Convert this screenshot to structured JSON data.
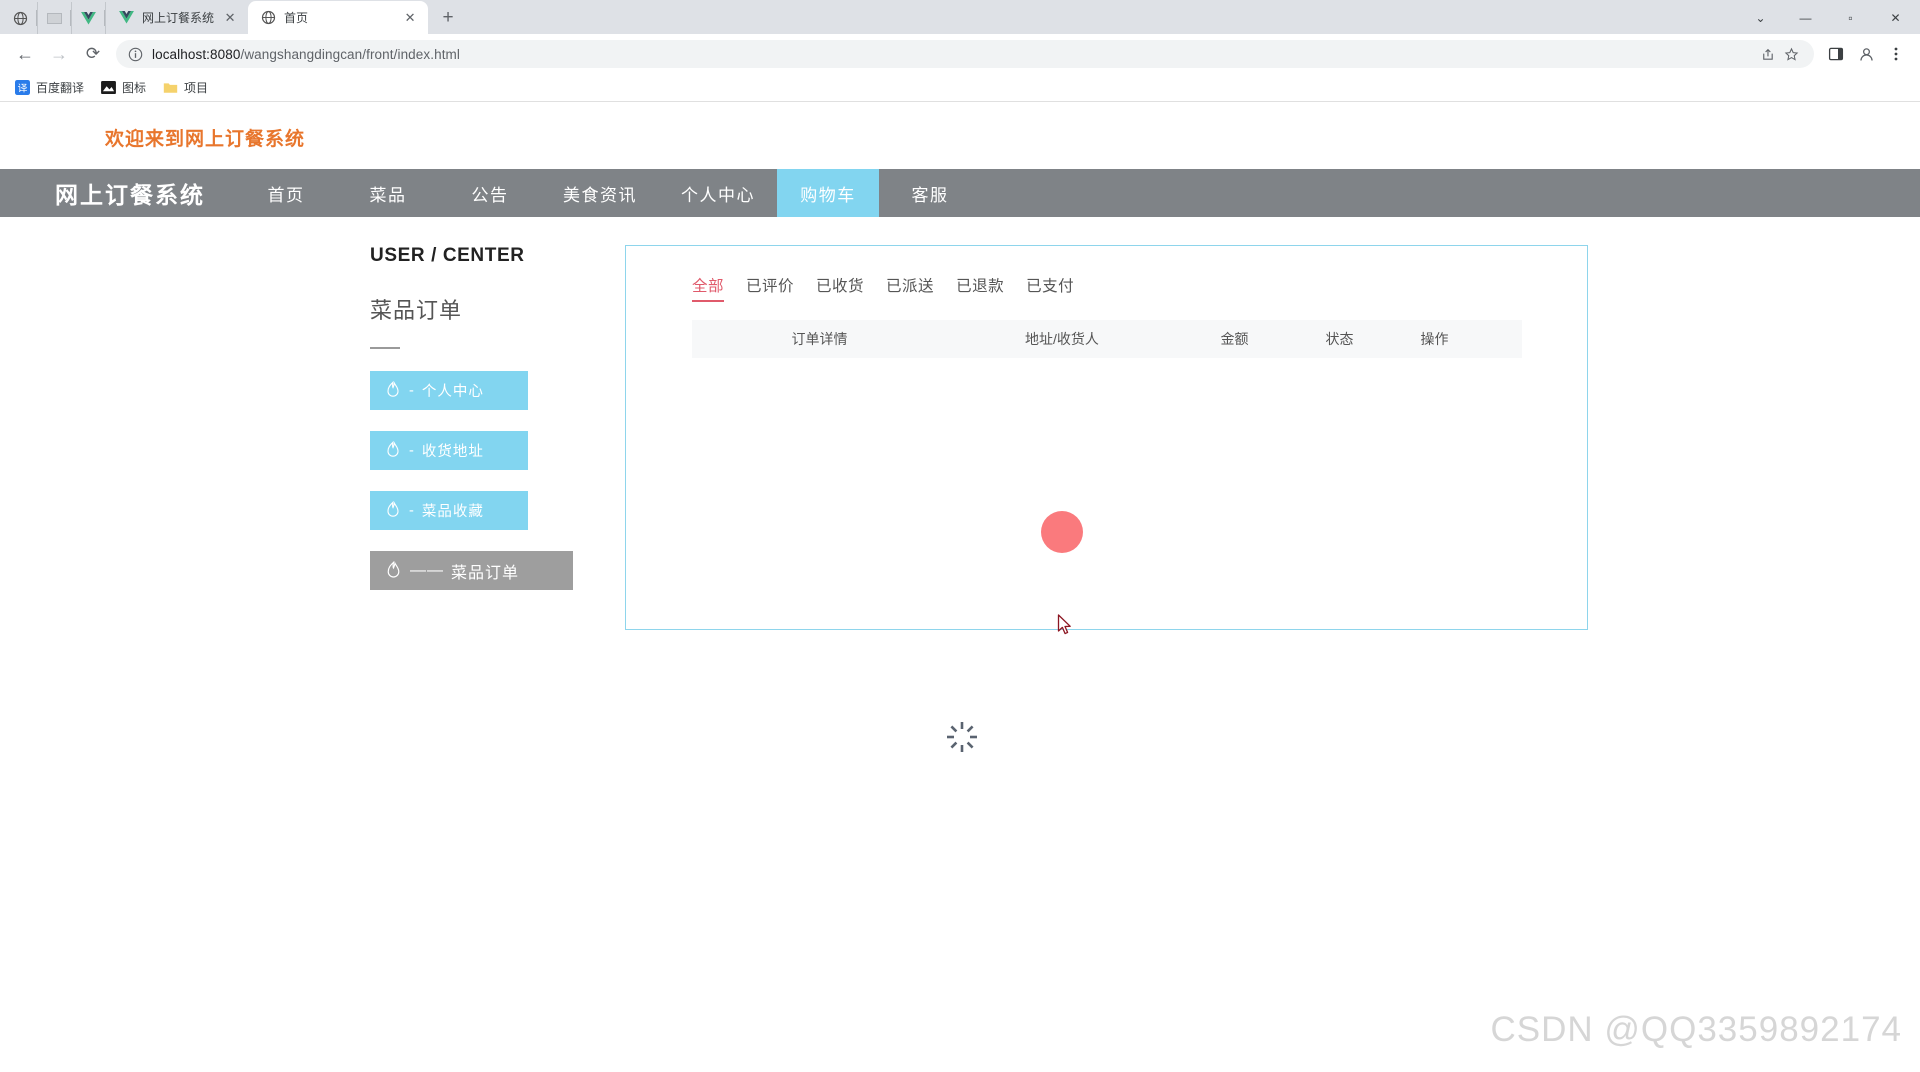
{
  "browser": {
    "mini_tabs": [
      {
        "icon": "globe-icon"
      },
      {
        "icon": "blank-page-icon"
      },
      {
        "icon": "vue-icon"
      }
    ],
    "tabs": [
      {
        "title": "网上订餐系统",
        "icon": "vue-icon",
        "active": false,
        "close_label": "✕"
      },
      {
        "title": "首页",
        "icon": "globe-icon",
        "active": true,
        "close_label": "✕"
      }
    ],
    "new_tab_label": "+",
    "window_controls": {
      "minimize": "—",
      "maximize": "▫",
      "close": "✕",
      "chevron": "⌄"
    },
    "nav": {
      "back": "←",
      "forward": "→",
      "reload": "⟳"
    },
    "omnibox": {
      "info_icon": "info-circle-icon",
      "url_host": "localhost:8080",
      "url_path": "/wangshangdingcan/front/index.html",
      "share_icon": "share-icon",
      "star_icon": "star-icon"
    },
    "toolbar_icons": {
      "sidepanel": "side-panel-icon",
      "profile": "profile-avatar-icon",
      "menu": "three-dot-menu-icon"
    },
    "bookmarks": [
      {
        "label": "百度翻译",
        "icon": "translate-icon"
      },
      {
        "label": "图标",
        "icon": "image-icon"
      },
      {
        "label": "项目",
        "icon": "folder-icon"
      }
    ]
  },
  "page": {
    "welcome_text": "欢迎来到网上订餐系统",
    "navbar": {
      "brand": "网上订餐系统",
      "items": [
        {
          "label": "首页",
          "active": false
        },
        {
          "label": "菜品",
          "active": false
        },
        {
          "label": "公告",
          "active": false
        },
        {
          "label": "美食资讯",
          "active": false
        },
        {
          "label": "个人中心",
          "active": false
        },
        {
          "label": "购物车",
          "active": true
        },
        {
          "label": "客服",
          "active": false
        }
      ]
    },
    "sidebar": {
      "title": "USER / CENTER",
      "subtitle": "菜品订单",
      "items": [
        {
          "label": "个人中心",
          "icon": "flame-icon",
          "separator": "-",
          "active": false
        },
        {
          "label": "收货地址",
          "icon": "flame-icon",
          "separator": "-",
          "active": false
        },
        {
          "label": "菜品收藏",
          "icon": "flame-icon",
          "separator": "-",
          "active": false
        },
        {
          "label": "菜品订单",
          "icon": "flame-icon",
          "separator": "——",
          "active": true
        }
      ]
    },
    "orders": {
      "tabs": [
        {
          "label": "全部",
          "active": true
        },
        {
          "label": "已评价",
          "active": false
        },
        {
          "label": "已收货",
          "active": false
        },
        {
          "label": "已派送",
          "active": false
        },
        {
          "label": "已退款",
          "active": false
        },
        {
          "label": "已支付",
          "active": false
        }
      ],
      "columns": [
        "订单详情",
        "地址/收货人",
        "金额",
        "状态",
        "操作"
      ],
      "rows": []
    },
    "loading_indicator": {
      "shape": "circle",
      "color": "#fa7a7d"
    },
    "spinner": {
      "name": "loading-spinner"
    },
    "watermark": "CSDN @QQ3359892174"
  }
}
